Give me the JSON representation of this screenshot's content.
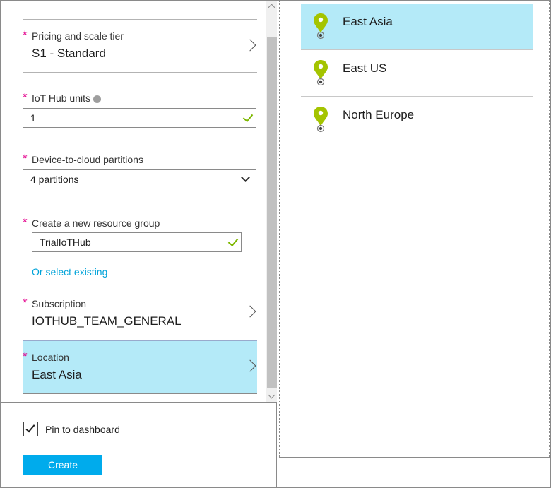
{
  "form": {
    "pricing": {
      "label": "Pricing and scale tier",
      "value": "S1 - Standard"
    },
    "iot_units": {
      "label": "IoT Hub units",
      "value": "1",
      "info_icon": "info-icon"
    },
    "partitions": {
      "label": "Device-to-cloud partitions",
      "value": "4 partitions"
    },
    "resource_group": {
      "label": "Create a new resource group",
      "value": "TrialIoTHub",
      "link": "Or select existing"
    },
    "subscription": {
      "label": "Subscription",
      "value": "IOTHUB_TEAM_GENERAL"
    },
    "location": {
      "label": "Location",
      "value": "East Asia"
    },
    "required_marker": "*"
  },
  "footer": {
    "pin_label": "Pin to dashboard",
    "pin_checked": true,
    "create_label": "Create"
  },
  "locations": {
    "items": [
      {
        "name": "East Asia",
        "selected": true
      },
      {
        "name": "East US",
        "selected": false
      },
      {
        "name": "North Europe",
        "selected": false
      }
    ]
  },
  "colors": {
    "accent": "#00abec",
    "selected_bg": "#b4eaf8",
    "required": "#e3008c",
    "valid_check": "#7db700",
    "pin_green": "#a4c400",
    "link": "#00a3d9"
  }
}
